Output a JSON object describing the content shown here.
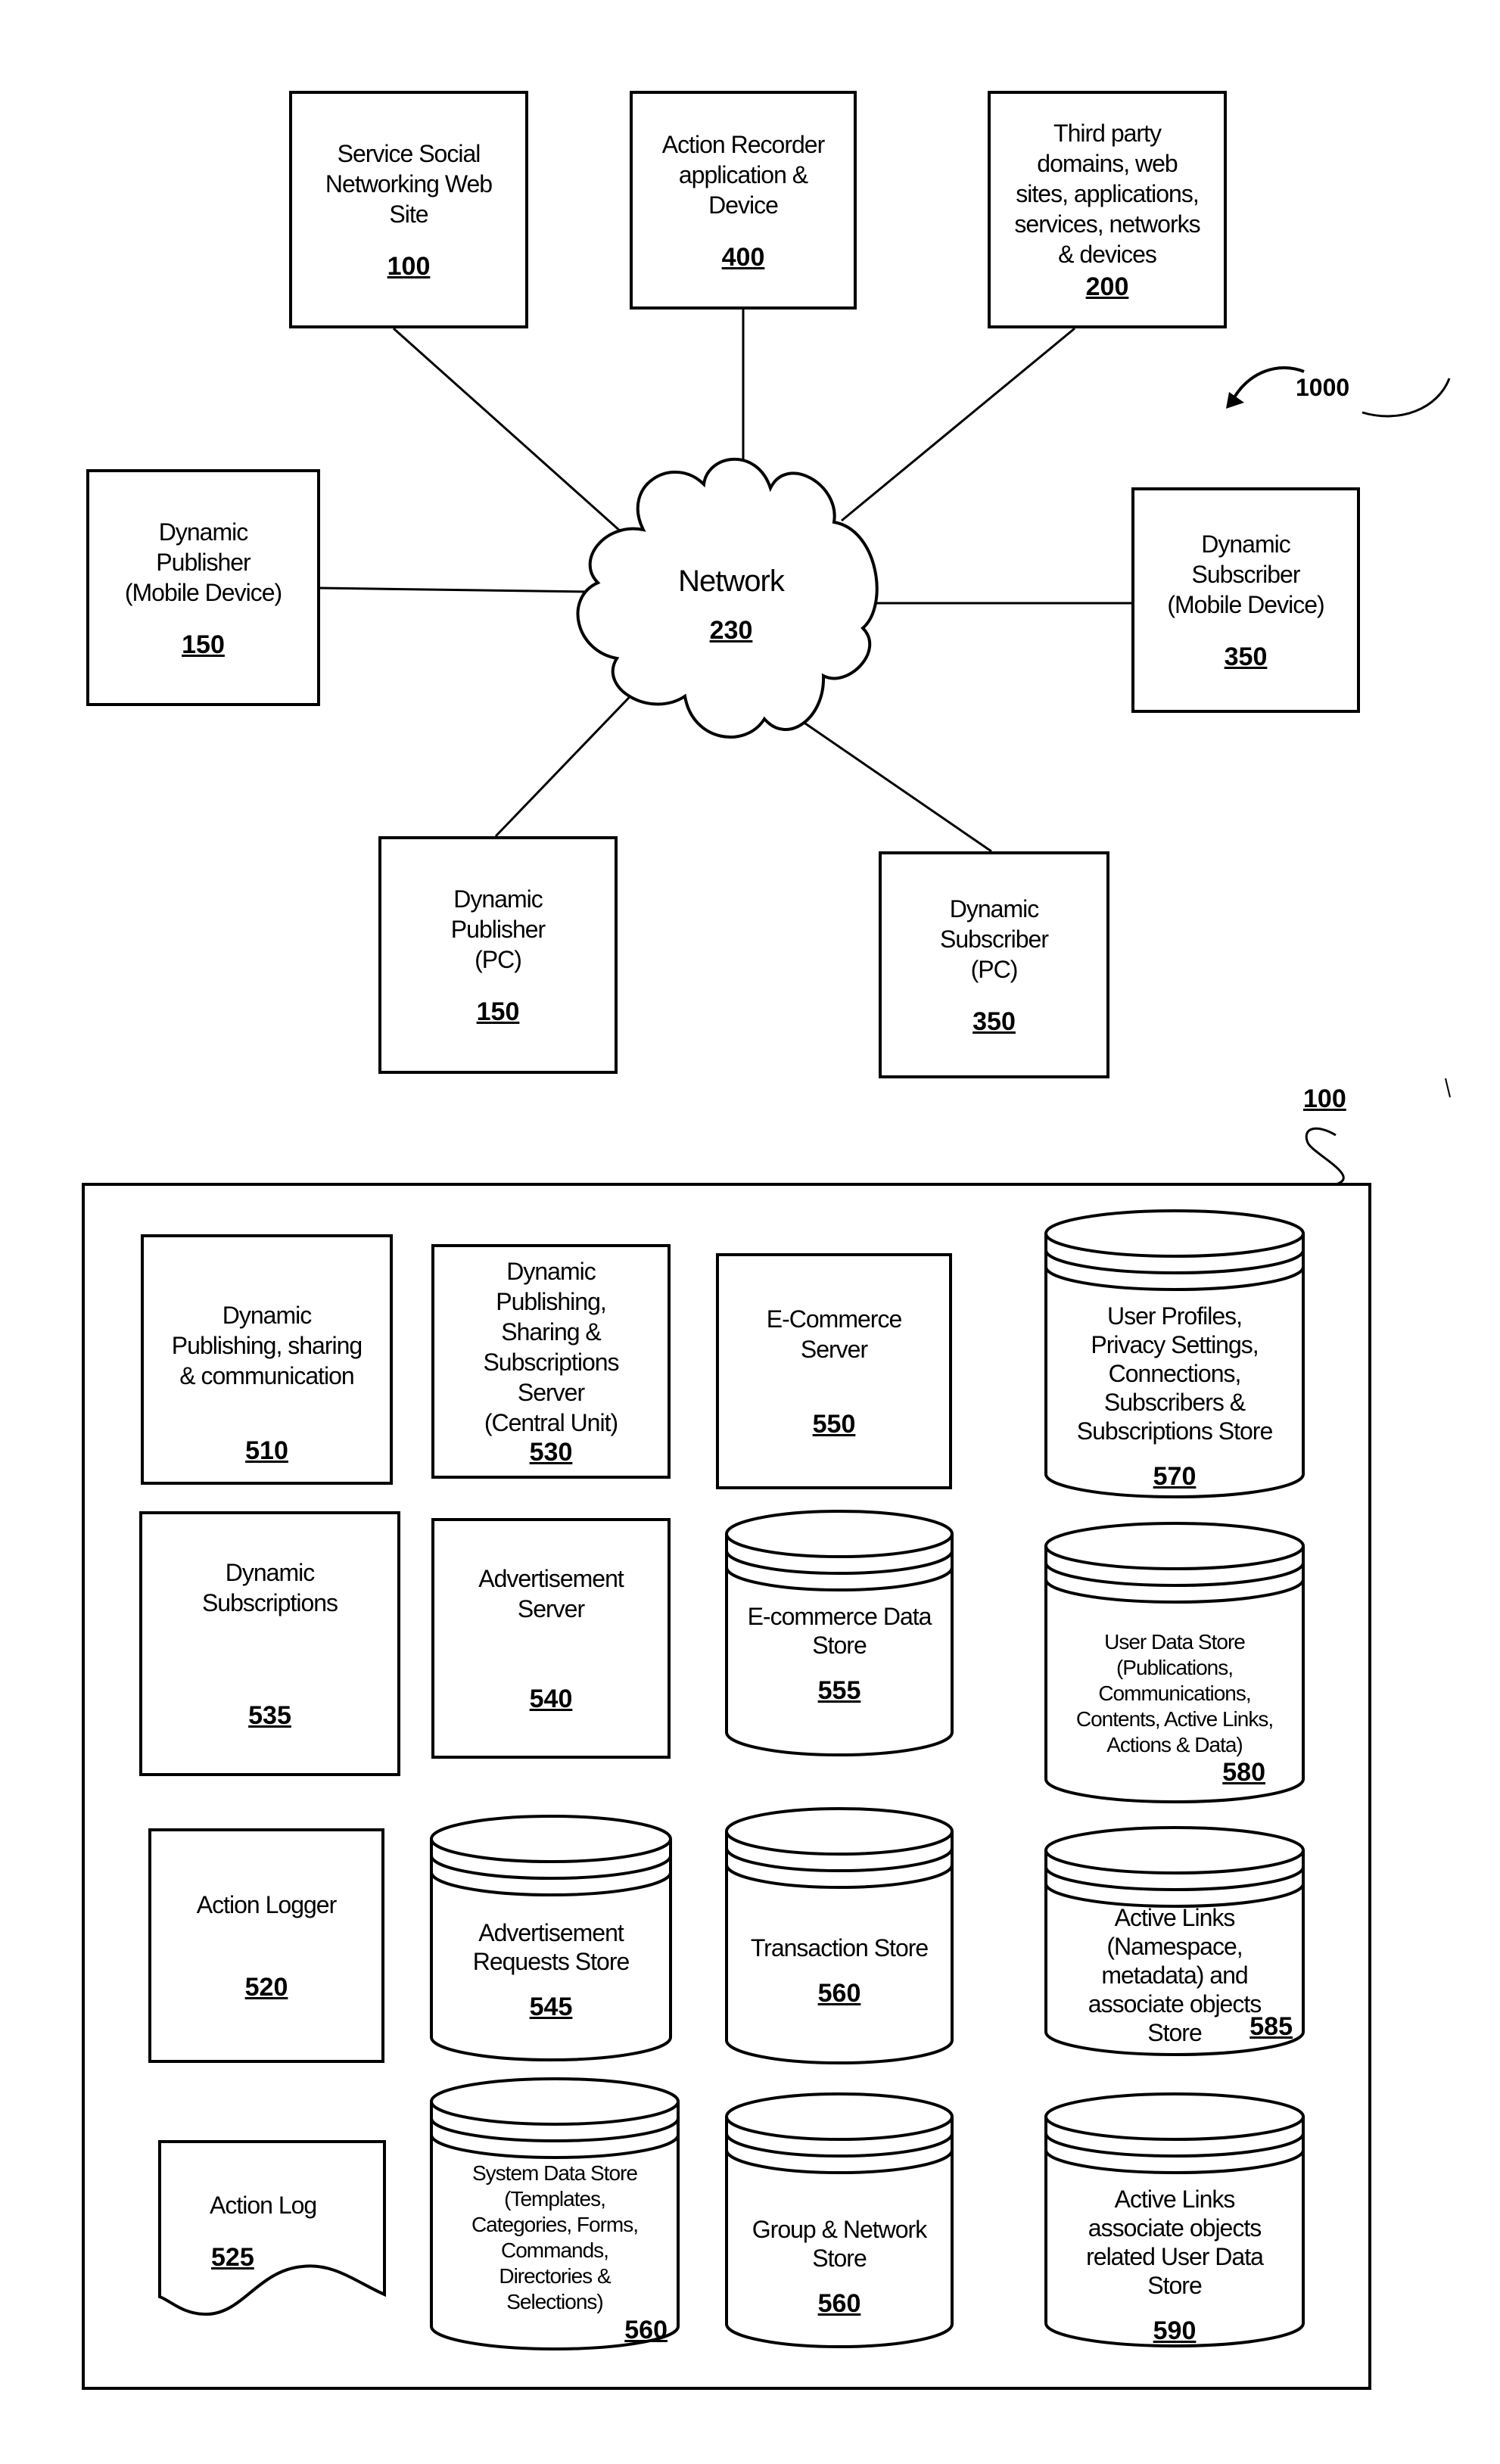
{
  "figure": {
    "reference": "1000",
    "server_reference": "100"
  },
  "network": {
    "label": "Network",
    "ref": "230"
  },
  "top_nodes": [
    {
      "id": "social-site",
      "label": "Service Social\nNetworking Web\nSite",
      "ref": "100"
    },
    {
      "id": "action-recorder",
      "label": "Action Recorder\napplication &\nDevice",
      "ref": "400"
    },
    {
      "id": "third-party",
      "label": "Third party\ndomains, web\nsites, applications,\nservices, networks\n& devices",
      "ref": "200"
    },
    {
      "id": "publisher-mobile",
      "label": "Dynamic\nPublisher\n(Mobile Device)",
      "ref": "150"
    },
    {
      "id": "subscriber-mobile",
      "label": "Dynamic\nSubscriber\n(Mobile Device)",
      "ref": "350"
    },
    {
      "id": "publisher-pc",
      "label": "Dynamic\nPublisher\n(PC)",
      "ref": "150"
    },
    {
      "id": "subscriber-pc",
      "label": "Dynamic\nSubscriber\n(PC)",
      "ref": "350"
    }
  ],
  "components": [
    {
      "id": "c510",
      "shape": "box",
      "label": "Dynamic\nPublishing, sharing\n& communication",
      "ref": "510"
    },
    {
      "id": "c530",
      "shape": "box",
      "label": "Dynamic\nPublishing,\nSharing &\nSubscriptions\nServer\n(Central Unit)",
      "ref": "530"
    },
    {
      "id": "c550",
      "shape": "box",
      "label": "E-Commerce\nServer",
      "ref": "550"
    },
    {
      "id": "c570",
      "shape": "cylinder",
      "label": "User Profiles,\nPrivacy Settings,\nConnections,\nSubscribers &\nSubscriptions Store",
      "ref": "570"
    },
    {
      "id": "c535",
      "shape": "box",
      "label": "Dynamic\nSubscriptions",
      "ref": "535"
    },
    {
      "id": "c540",
      "shape": "box",
      "label": "Advertisement\nServer",
      "ref": "540"
    },
    {
      "id": "c555",
      "shape": "cylinder",
      "label": "E-commerce Data\nStore",
      "ref": "555"
    },
    {
      "id": "c580",
      "shape": "cylinder",
      "label": "User Data Store\n(Publications,\nCommunications,\nContents, Active Links,\nActions & Data)",
      "ref": "580"
    },
    {
      "id": "c520",
      "shape": "box",
      "label": "Action Logger",
      "ref": "520"
    },
    {
      "id": "c545",
      "shape": "cylinder",
      "label": "Advertisement\nRequests Store",
      "ref": "545"
    },
    {
      "id": "c560t",
      "shape": "cylinder",
      "label": "Transaction Store",
      "ref": "560"
    },
    {
      "id": "c585",
      "shape": "cylinder",
      "label": "Active Links\n(Namespace,\nmetadata) and\nassociate objects\nStore",
      "ref": "585"
    },
    {
      "id": "c525",
      "shape": "document",
      "label": "Action Log",
      "ref": "525"
    },
    {
      "id": "c560s",
      "shape": "cylinder",
      "label": "System Data Store\n(Templates,\nCategories, Forms,\nCommands,\nDirectories &\nSelections)",
      "ref": "560"
    },
    {
      "id": "c560g",
      "shape": "cylinder",
      "label": "Group & Network\nStore",
      "ref": "560"
    },
    {
      "id": "c590",
      "shape": "cylinder",
      "label": "Active Links\nassociate objects\nrelated User Data\nStore",
      "ref": "590"
    }
  ]
}
